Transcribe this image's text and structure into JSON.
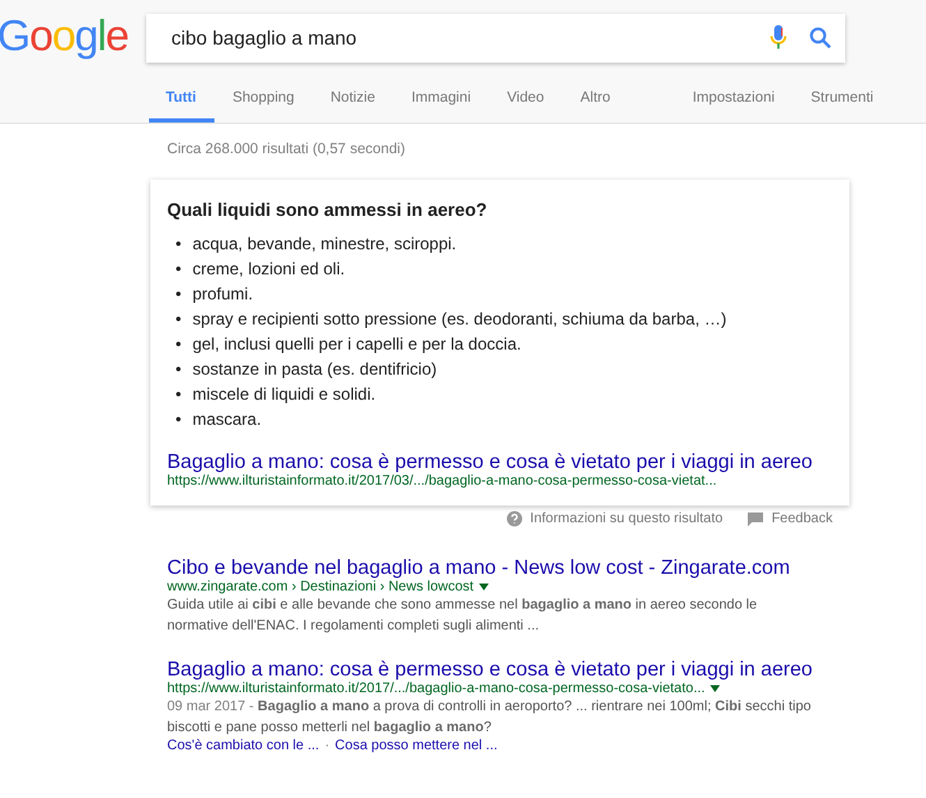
{
  "logo": "Google",
  "search": {
    "value": "cibo bagaglio a mano"
  },
  "tabs": [
    {
      "label": "Tutti",
      "selected": true
    },
    {
      "label": "Shopping",
      "selected": false
    },
    {
      "label": "Notizie",
      "selected": false
    },
    {
      "label": "Immagini",
      "selected": false
    },
    {
      "label": "Video",
      "selected": false
    },
    {
      "label": "Altro",
      "selected": false
    }
  ],
  "tools": [
    "Impostazioni",
    "Strumenti"
  ],
  "result_stats": "Circa 268.000 risultati (0,57 secondi)",
  "featured_snippet": {
    "question": "Quali liquidi sono ammessi in aereo?",
    "bullet": "•",
    "items": [
      "acqua, bevande, minestre, sciroppi.",
      "creme, lozioni ed oli.",
      "profumi.",
      "spray e recipienti sotto pressione (es. deodoranti, schiuma da barba, …)",
      "gel, inclusi quelli per i capelli e per la doccia.",
      "sostanze in pasta (es. dentifricio)",
      "miscele di liquidi e solidi.",
      "mascara."
    ],
    "title": "Bagaglio a mano: cosa è permesso e cosa è vietato per i viaggi in aereo",
    "url": "https://www.ilturistainformato.it/2017/03/.../bagaglio-a-mano-cosa-permesso-cosa-vietat..."
  },
  "snippet_footer": {
    "about": "Informazioni su questo risultato",
    "feedback": "Feedback"
  },
  "results": [
    {
      "title": "Cibo e bevande nel bagaglio a mano - News low cost - Zingarate.com",
      "url": "www.zingarate.com › Destinazioni › News lowcost",
      "description": "Guida utile ai **cibi** e alle bevande che sono ammesse nel **bagaglio a mano** in aereo secondo le normative dell'ENAC. I regolamenti completi sugli alimenti ..."
    },
    {
      "title": "Bagaglio a mano: cosa è permesso e cosa è vietato per i viaggi in aereo",
      "url": "https://www.ilturistainformato.it/2017/.../bagaglio-a-mano-cosa-permesso-cosa-vietato...",
      "date": "09 mar 2017 - ",
      "description": "**Bagaglio a mano** a prova di controlli in aeroporto? ... rientrare nei 100ml; **Cibi** secchi tipo biscotti e pane posso metterli nel **bagaglio a mano**?",
      "sitelinks": [
        "Cos'è cambiato con le ...",
        "Cosa posso mettere nel ..."
      ],
      "sitelink_separator": "·"
    }
  ]
}
